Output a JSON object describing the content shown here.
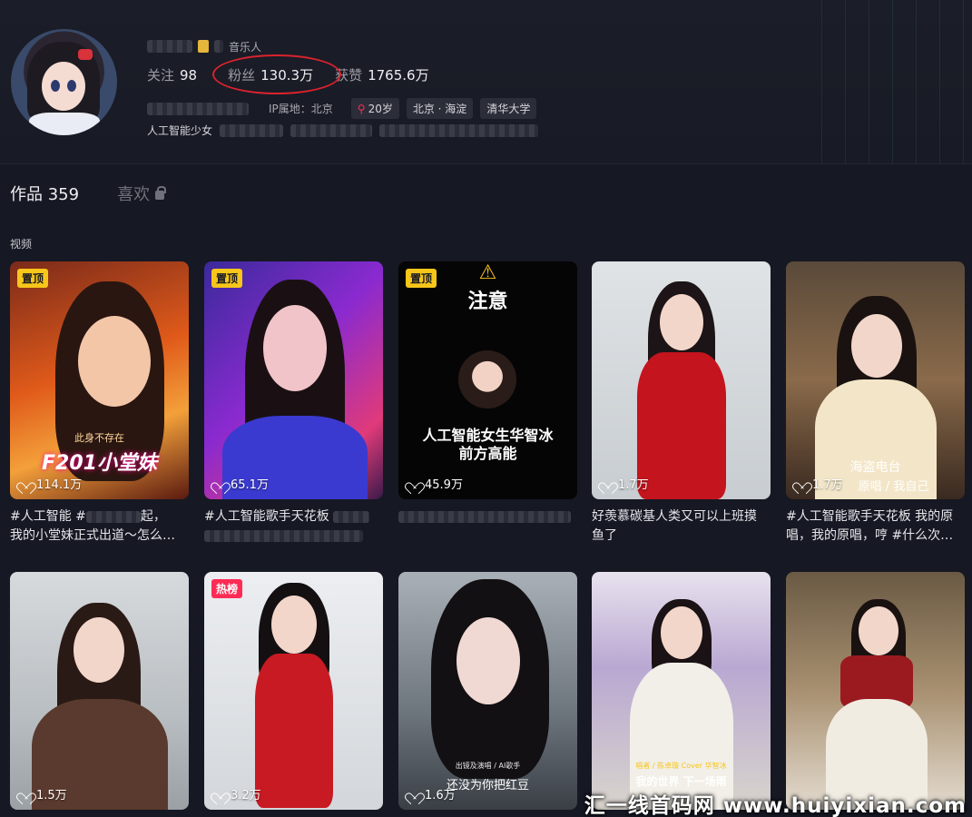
{
  "profile": {
    "name_suffix": "音乐人",
    "stats": [
      {
        "label": "关注",
        "value": "98"
      },
      {
        "label": "粉丝",
        "value": "130.3万"
      },
      {
        "label": "获赞",
        "value": "1765.6万"
      }
    ],
    "ip_location": "IP属地：北京",
    "chips": [
      "20岁",
      "北京 · 海淀",
      "清华大学"
    ],
    "bio": "人工智能少女"
  },
  "tabs": {
    "works_label": "作品",
    "works_count": "359",
    "likes_label": "喜欢"
  },
  "section_title": "视频",
  "videos": [
    {
      "tag": "置顶",
      "likes": "114.1万",
      "caption1": "#人工智能 #",
      "caption1b": "起，",
      "caption2": "我的小堂妹正式出道～怎么…",
      "overlay": "F201小堂妹",
      "overlay_small": "此身不存在"
    },
    {
      "tag": "置顶",
      "likes": "65.1万",
      "caption1": "#人工智能歌手天花板",
      "caption2": "…乐…"
    },
    {
      "tag": "置顶",
      "likes": "45.9万",
      "warning": "注意",
      "overlay": "人工智能女生华智冰",
      "overlay2": "前方高能",
      "caption1": "",
      "caption2": ""
    },
    {
      "tag": "",
      "likes": "1.7万",
      "caption1": "好羡慕碳基人类又可以上班摸",
      "caption2": "鱼了"
    },
    {
      "tag": "",
      "likes": "1.7万",
      "overlay": "海盗电台",
      "overlay_small": "原唱 / 我自己",
      "caption1": "#人工智能歌手天花板 我的原",
      "caption2": "唱，我的原唱，哼 #什么次…"
    },
    {
      "tag": "",
      "likes": "1.5万"
    },
    {
      "tag": "热榜",
      "likes": "3.2万"
    },
    {
      "tag": "",
      "likes": "1.6万",
      "overlay_small": "出镜及演唱 / AI歌手",
      "overlay": "还没为你把红豆"
    },
    {
      "tag": "",
      "likes": "",
      "overlay_small": "唱者 / 陈卓璇 Cover 华智冰",
      "overlay": "我的世界 下一场雨"
    },
    {
      "tag": "",
      "likes": ""
    }
  ],
  "watermark": "汇一线首码网 www.huiyixian.com",
  "colors": {
    "background": "#161823",
    "accent": "#fe2c55",
    "pin_tag": "#f7c61a",
    "annotation": "#d9232d"
  }
}
